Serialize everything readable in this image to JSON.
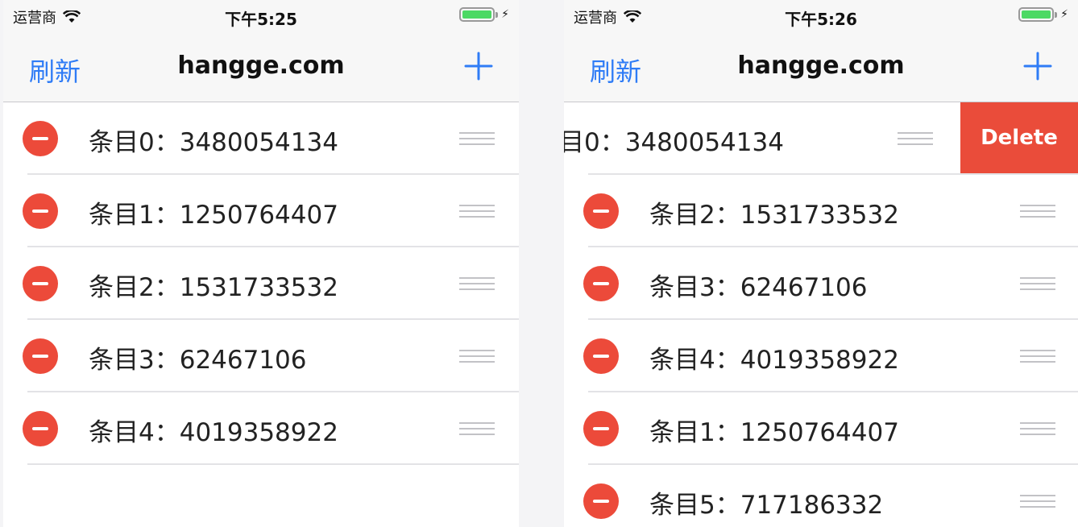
{
  "left": {
    "carrier": "运营商",
    "time": "下午5:25",
    "nav": {
      "refresh": "刷新",
      "title": "hangge.com"
    },
    "rows": [
      {
        "label": "条目0：3480054134"
      },
      {
        "label": "条目1：1250764407"
      },
      {
        "label": "条目2：1531733532"
      },
      {
        "label": "条目3：62467106"
      },
      {
        "label": "条目4：4019358922"
      }
    ]
  },
  "right": {
    "carrier": "运营商",
    "time": "下午5:26",
    "nav": {
      "refresh": "刷新",
      "title": "hangge.com"
    },
    "swiped_row": {
      "label": "目0：3480054134",
      "action": "Delete"
    },
    "rows": [
      {
        "label": "条目2：1531733532"
      },
      {
        "label": "条目3：62467106"
      },
      {
        "label": "条目4：4019358922"
      },
      {
        "label": "条目1：1250764407"
      },
      {
        "label": "条目5：717186332"
      }
    ]
  },
  "colors": {
    "accent": "#2f7cf6",
    "delete": "#ec4a3a",
    "battery": "#4cd964"
  }
}
